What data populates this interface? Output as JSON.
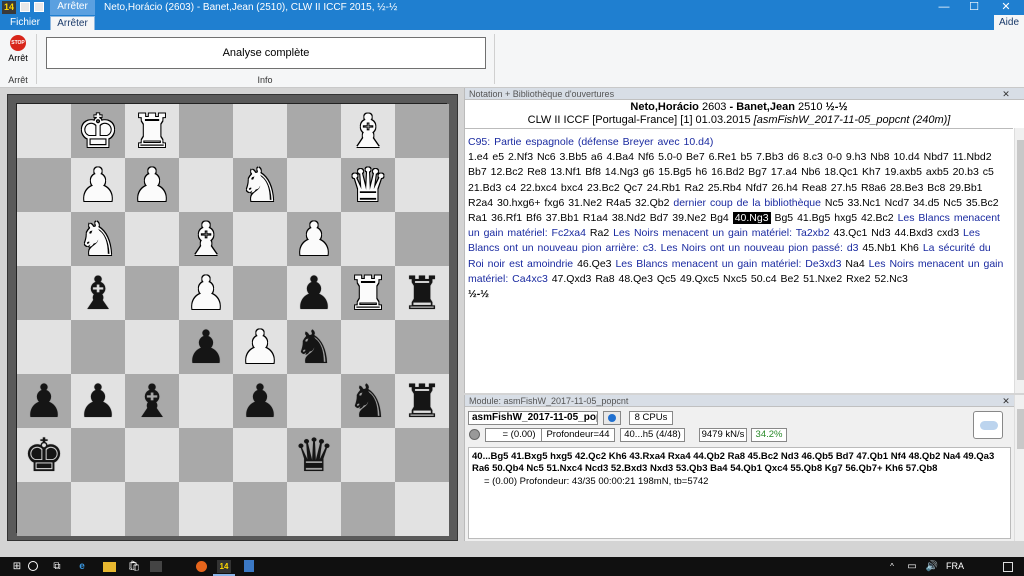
{
  "titlebar": {
    "app_icon": "14",
    "context_tab": "Arrêter",
    "title": "Neto,Horácio (2603) - Banet,Jean (2510), CLW II ICCF 2015, ½-½",
    "minimize": "—",
    "maximize": "☐",
    "close": "✕"
  },
  "ribbon": {
    "tab_file": "Fichier",
    "tab_active": "Arrêter",
    "help": "Aide",
    "stop_icon_text": "STOP",
    "stop_label": "Arrêt",
    "group_arret": "Arrêt",
    "analyse_button": "Analyse complète",
    "group_info": "Info"
  },
  "board": {
    "pieces": [
      {
        "sq": "b8",
        "glyph": "♚",
        "color": "w"
      },
      {
        "sq": "c8",
        "glyph": "♜",
        "color": "w"
      },
      {
        "sq": "g8",
        "glyph": "♝",
        "color": "w"
      },
      {
        "sq": "b7",
        "glyph": "♟",
        "color": "w"
      },
      {
        "sq": "c7",
        "glyph": "♟",
        "color": "w"
      },
      {
        "sq": "e7",
        "glyph": "♞",
        "color": "w"
      },
      {
        "sq": "g7",
        "glyph": "♛",
        "color": "w"
      },
      {
        "sq": "b6",
        "glyph": "♞",
        "color": "w"
      },
      {
        "sq": "d6",
        "glyph": "♝",
        "color": "w"
      },
      {
        "sq": "f6",
        "glyph": "♟",
        "color": "w"
      },
      {
        "sq": "b5",
        "glyph": "♝",
        "color": "b"
      },
      {
        "sq": "d5",
        "glyph": "♟",
        "color": "w"
      },
      {
        "sq": "f5",
        "glyph": "♟",
        "color": "b"
      },
      {
        "sq": "g5",
        "glyph": "♜",
        "color": "w"
      },
      {
        "sq": "h5",
        "glyph": "♜",
        "color": "b"
      },
      {
        "sq": "d4",
        "glyph": "♟",
        "color": "b"
      },
      {
        "sq": "e4",
        "glyph": "♟",
        "color": "w"
      },
      {
        "sq": "f4",
        "glyph": "♞",
        "color": "b"
      },
      {
        "sq": "a3",
        "glyph": "♟",
        "color": "b"
      },
      {
        "sq": "b3",
        "glyph": "♟",
        "color": "b"
      },
      {
        "sq": "c3",
        "glyph": "♝",
        "color": "b"
      },
      {
        "sq": "e3",
        "glyph": "♟",
        "color": "b"
      },
      {
        "sq": "g3",
        "glyph": "♞",
        "color": "b"
      },
      {
        "sq": "h3",
        "glyph": "♜",
        "color": "b"
      },
      {
        "sq": "a2",
        "glyph": "♚",
        "color": "b"
      },
      {
        "sq": "f2",
        "glyph": "♛",
        "color": "b"
      }
    ]
  },
  "notation": {
    "panel_title": "Notation + Bibliothèque d'ouvertures",
    "close": "✕",
    "white_player": "Neto,Horácio",
    "white_elo": "2603",
    "separator": "-",
    "black_player": "Banet,Jean",
    "black_elo": "2510",
    "result": "½-½",
    "event": "CLW II ICCF [Portugal-France] [1] 01.03.2015",
    "annotator": "[asmFishW_2017-11-05_popcnt (240m)]",
    "opening": "C95: Partie espagnole (défense Breyer avec 10.d4)",
    "moves_1": "1.e4 e5 2.Nf3 Nc6 3.Bb5 a6 4.Ba4 Nf6 5.0-0 Be7 6.Re1 b5 7.Bb3 d6 8.c3 0-0 9.h3 Nb8 10.d4 Nbd7 11.Nbd2 Bb7 12.Bc2 Re8 13.Nf1 Bf8 14.Ng3 g6 15.Bg5 h6 16.Bd2 Bg7 17.a4 Nb6 18.Qc1 Kh7 19.axb5 axb5 20.b3 c5 21.Bd3 c4 22.bxc4 bxc4 23.Bc2 Qc7 24.Rb1 Ra2 25.Rb4 Nfd7 26.h4 Rea8 27.h5 R8a6 28.Be3 Bc8 29.Bb1 R2a4 30.hxg6+ fxg6 31.Ne2 R4a5 32.Qb2",
    "library_note": "dernier coup de la bibliothèque",
    "moves_2": "Nc5 33.Nc1 Ncd7 34.d5 Nc5 35.Bc2 Ra1 36.Rf1 Bf6 37.Bb1 R1a4 38.Nd2 Bd7 39.Ne2 Bg4",
    "current_move": "40.Ng3",
    "moves_3": "Bg5 41.Bg5 hxg5 42.Bc2",
    "comment_1": "Les Blancs menacent un gain matériel: Fc2xa4",
    "moves_4": "Ra2",
    "comment_2": "Les Noirs menacent un gain matériel: Ta2xb2",
    "moves_5": "43.Qc1 Nd3 44.Bxd3 cxd3",
    "comment_3": "Les Blancs ont un nouveau pion arrière: c3. Les Noirs ont un nouveau pion passé: d3",
    "moves_6": "45.Nb1 Kh6",
    "comment_4": "La sécurité du Roi noir est amoindrie",
    "moves_7": "46.Qe3",
    "comment_5": "Les Blancs menacent un gain matériel: De3xd3",
    "moves_8": "Na4",
    "comment_6": "Les Noirs menacent un gain matériel: Ca4xc3",
    "moves_9": "47.Qxd3 Ra8 48.Qe3 Qc5 49.Qxc5 Nxc5 50.c4 Be2 51.Nxe2 Rxe2 52.Nc3",
    "final_result": "½-½"
  },
  "engine": {
    "panel_title": "Module: asmFishW_2017-11-05_popcnt",
    "close": "✕",
    "name": "asmFishW_2017-11-05_popcnt",
    "cpus": "8 CPUs",
    "eval": "= (0.00)",
    "depth": "Profondeur=44",
    "current_move": "40...h5 (4/48)",
    "speed": "9479 kN/s",
    "percent": "34.2%",
    "line": "40...Bg5 41.Bxg5 hxg5 42.Qc2 Kh6 43.Rxa4 Rxa4 44.Qb2 Ra8 45.Bc2 Nd3 46.Qb5 Bd7 47.Qb1 Nf4 48.Qb2 Na4 49.Qa3 Ra6 50.Qb4 Nc5 51.Nxc4 Ncd3 52.Bxd3 Nxd3 53.Qb3 Ba4 54.Qb1 Qxc4 55.Qb8 Kg7 56.Qb7+ Kh6 57.Qb8",
    "info": "= (0.00)   Profondeur: 43/35   00:00:21   198mN, tb=5742"
  },
  "taskbar": {
    "windows": "⊞",
    "taskview": "⧉",
    "edge": "e",
    "store": "🛍",
    "chess": "14",
    "tray_up": "^",
    "network": "▭",
    "volume": "🔊",
    "language": "FRA",
    "notify": ""
  }
}
